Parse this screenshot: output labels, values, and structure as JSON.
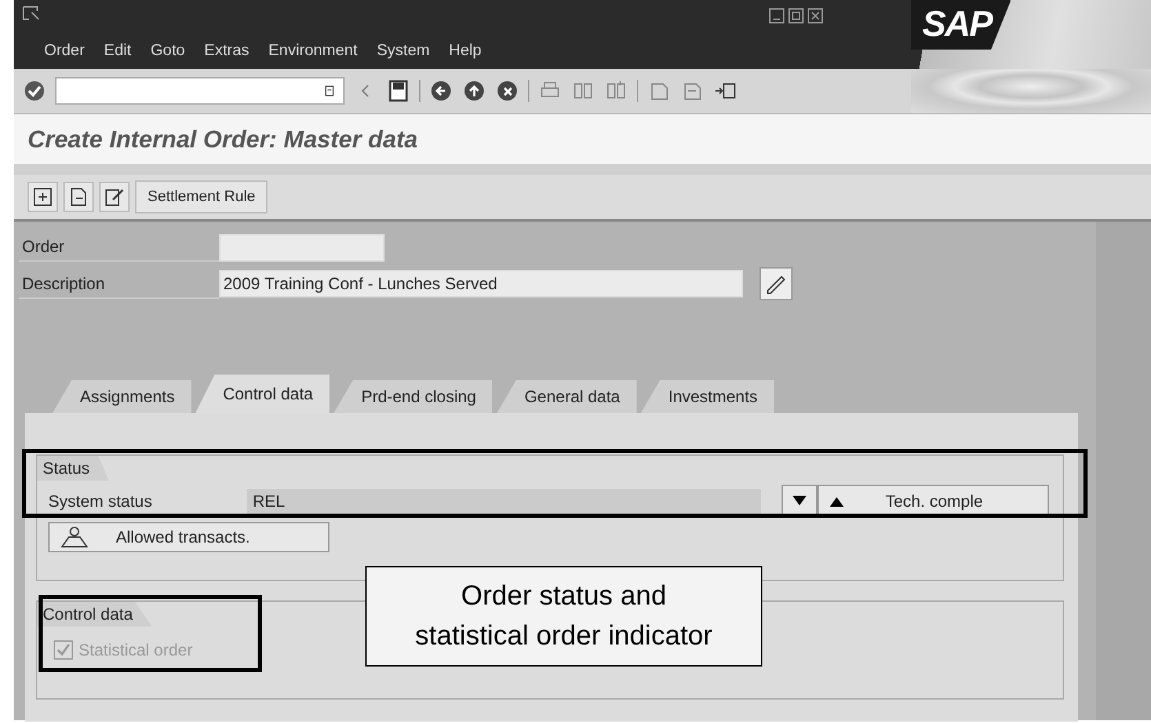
{
  "menu_bar": {
    "items": [
      "Order",
      "Edit",
      "Goto",
      "Extras",
      "Environment",
      "System",
      "Help"
    ],
    "logo": "SAP"
  },
  "screen_title": "Create Internal Order: Master data",
  "app_toolbar": {
    "buttons": [
      "Settlement Rule"
    ]
  },
  "header_fields": [
    {
      "label": "Order"
    },
    {
      "label": "Description",
      "value": "2009 Training Conf - Lunches Served"
    }
  ],
  "tabs": [
    {
      "label": "Assignments",
      "selected": false
    },
    {
      "label": "Control data",
      "selected": true
    },
    {
      "label": "Prd-end closing",
      "selected": false
    },
    {
      "label": "General data",
      "selected": false
    },
    {
      "label": "Investments",
      "selected": false
    }
  ],
  "status_group": {
    "title": "Status",
    "label": "System status",
    "value": "REL",
    "action_button": "Tech. comple",
    "transactions_button": "Allowed transacts."
  },
  "control_group": {
    "title": "Control data",
    "checkbox": {
      "label": "Statistical order",
      "checked": true,
      "disabled": true
    }
  },
  "callout": "Order status and statistical order indicator"
}
